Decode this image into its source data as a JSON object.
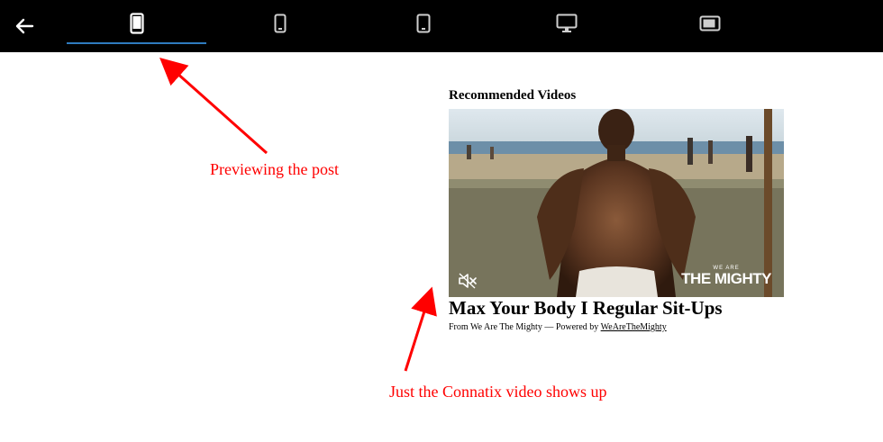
{
  "toolbar": {
    "back_icon": "arrow-left-icon",
    "tabs": [
      {
        "icon": "phone-portrait-icon",
        "selected": true
      },
      {
        "icon": "phone-portrait-small-icon",
        "selected": false
      },
      {
        "icon": "tablet-portrait-icon",
        "selected": false
      },
      {
        "icon": "desktop-monitor-icon",
        "selected": false
      },
      {
        "icon": "tablet-landscape-icon",
        "selected": false
      }
    ],
    "accent_color": "#2f7bbf"
  },
  "preview": {
    "section_title": "Recommended Videos",
    "video": {
      "title": "Max Your Body I Regular Sit-Ups",
      "byline_prefix": "From We Are The Mighty — Powered by ",
      "byline_link": "WeAreTheMighty",
      "watermark_top": "WE ARE",
      "watermark_main": "THE MIGHTY",
      "mute_icon": "speaker-muted-icon"
    }
  },
  "annotations": {
    "color": "#ff0000",
    "notes": [
      {
        "text": "Previewing the post"
      },
      {
        "text": "Just the Connatix video shows up"
      }
    ]
  }
}
